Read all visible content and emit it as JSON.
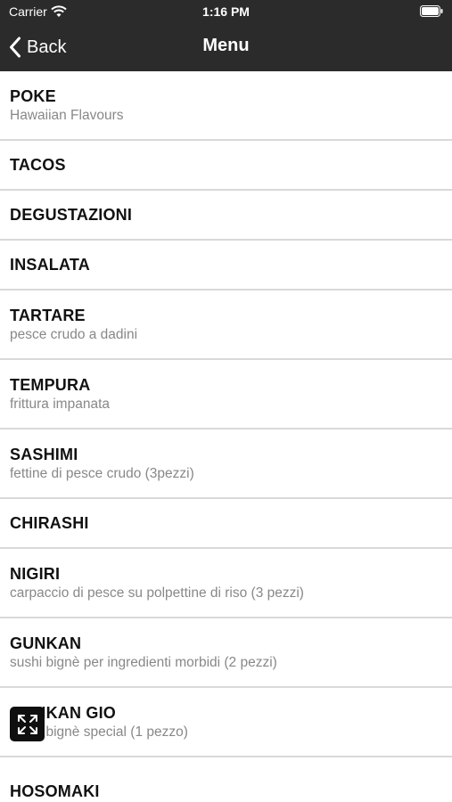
{
  "status_bar": {
    "carrier": "Carrier",
    "time": "1:16 PM"
  },
  "nav": {
    "back_label": "Back",
    "title": "Menu"
  },
  "menu": {
    "items": [
      {
        "title": "POKE",
        "subtitle": "Hawaiian Flavours"
      },
      {
        "title": "TACOS",
        "subtitle": ""
      },
      {
        "title": "DEGUSTAZIONI",
        "subtitle": ""
      },
      {
        "title": "INSALATA",
        "subtitle": ""
      },
      {
        "title": "TARTARE",
        "subtitle": "pesce crudo a dadini"
      },
      {
        "title": "TEMPURA",
        "subtitle": "frittura impanata"
      },
      {
        "title": "SASHIMI",
        "subtitle": "fettine di pesce crudo (3pezzi)"
      },
      {
        "title": "CHIRASHI",
        "subtitle": ""
      },
      {
        "title": "NIGIRI",
        "subtitle": "carpaccio di pesce su polpettine di riso (3 pezzi)"
      },
      {
        "title": "GUNKAN",
        "subtitle": "sushi bignè per ingredienti morbidi (2 pezzi)"
      },
      {
        "title": "GUNKAN GIO",
        "subtitle": "sushi bignè special (1 pezzo)"
      },
      {
        "title": "HOSOMAKI",
        "subtitle": ""
      }
    ]
  },
  "icons": {
    "wifi": "wifi-icon",
    "battery": "battery-icon",
    "back": "chevron-left-icon",
    "expand": "expand-icon"
  },
  "colors": {
    "header_bg": "#2b2b2b",
    "divider": "#d9d9d9",
    "subtitle": "#888888"
  }
}
